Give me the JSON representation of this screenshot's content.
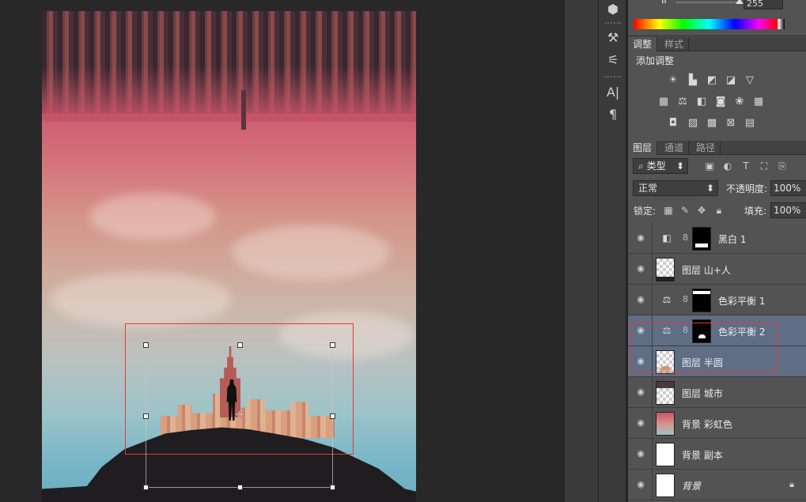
{
  "color_panel": {
    "channel_label": "B",
    "channel_value": "255"
  },
  "adjustments_panel": {
    "tabs": [
      {
        "label": "调整",
        "active": true
      },
      {
        "label": "样式",
        "active": false
      }
    ],
    "title": "添加调整",
    "icons_row1": [
      "brightness-icon",
      "levels-icon",
      "curves-icon",
      "exposure-icon",
      "vibrance-icon"
    ],
    "icons_row2": [
      "hue-saturation-icon",
      "color-balance-icon",
      "black-white-icon",
      "photo-filter-icon",
      "channel-mixer-icon",
      "color-lookup-icon"
    ],
    "icons_row3": [
      "invert-icon",
      "posterize-icon",
      "threshold-icon",
      "selective-color-icon",
      "gradient-map-icon"
    ]
  },
  "layers_panel": {
    "tabs": [
      {
        "label": "图层",
        "active": true
      },
      {
        "label": "通道",
        "active": false
      },
      {
        "label": "路径",
        "active": false
      }
    ],
    "filter_label": "类型",
    "blend_mode": "正常",
    "opacity_label": "不透明度:",
    "opacity_value": "100%",
    "lock_label": "锁定:",
    "fill_label": "填充:",
    "fill_value": "100%",
    "layers": [
      {
        "name": "黑白 1",
        "type": "adjustment",
        "icon": "black-white-icon",
        "selected": false
      },
      {
        "name": "图层 山+人",
        "type": "pixel",
        "selected": false
      },
      {
        "name": "色彩平衡 1",
        "type": "adjustment",
        "icon": "color-balance-icon",
        "selected": false
      },
      {
        "name": "色彩平衡 2",
        "type": "adjustment",
        "icon": "color-balance-icon",
        "selected": true
      },
      {
        "name": "图层 半圆",
        "type": "pixel",
        "selected": true
      },
      {
        "name": "图层 城市",
        "type": "pixel",
        "selected": false
      },
      {
        "name": "背景 彩虹色",
        "type": "pixel",
        "selected": false
      },
      {
        "name": "背景 副本",
        "type": "pixel",
        "selected": false
      },
      {
        "name": "背景",
        "type": "background",
        "locked": true,
        "selected": false
      }
    ]
  },
  "colors": {
    "selection_outline": "#e03a3a",
    "selected_row": "#5f6d85"
  }
}
